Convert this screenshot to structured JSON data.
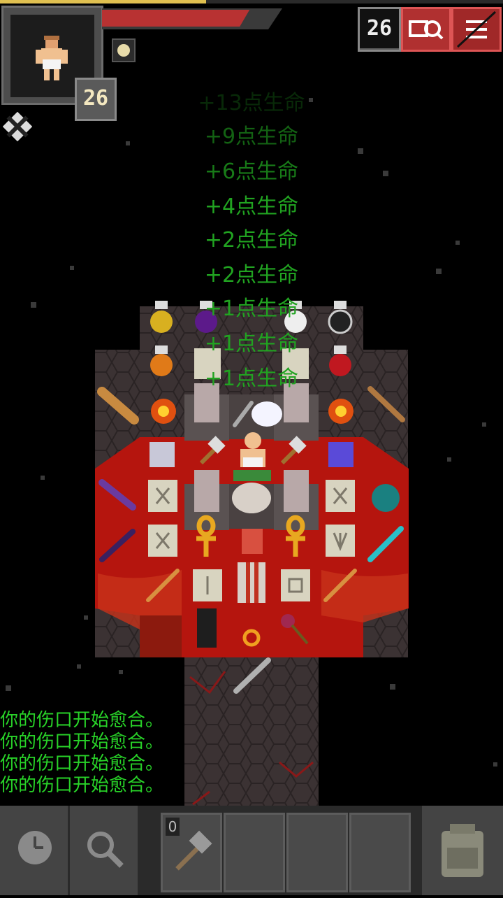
{
  "hud": {
    "hero_level": "26",
    "depth": "26",
    "hp_fraction": 0.88,
    "xp_fraction": 0.41
  },
  "floating_text": [
    "+13点生命",
    "+9点生命",
    "+6点生命",
    "+4点生命",
    "+2点生命",
    "+2点生命",
    "+1点生命",
    "+1点生命",
    "+1点生命"
  ],
  "log": [
    "你的伤口开始愈合。",
    "你的伤口开始愈合。",
    "你的伤口开始愈合。",
    "你的伤口开始愈合。"
  ],
  "quickslot": {
    "count": "0"
  },
  "colors": {
    "heal_text": "#21a321",
    "log_text": "#28d228",
    "hp_bar": "#b83232",
    "xp_bar": "#e0c050",
    "lava": "#b5150e",
    "floor": "#3b3233"
  },
  "icons": {
    "journal": "search-journal-icon",
    "menu": "menu-icon",
    "wait": "clock-icon",
    "search": "magnifier-icon",
    "backpack": "backpack-icon",
    "quickslot_item": "hammer-icon"
  }
}
